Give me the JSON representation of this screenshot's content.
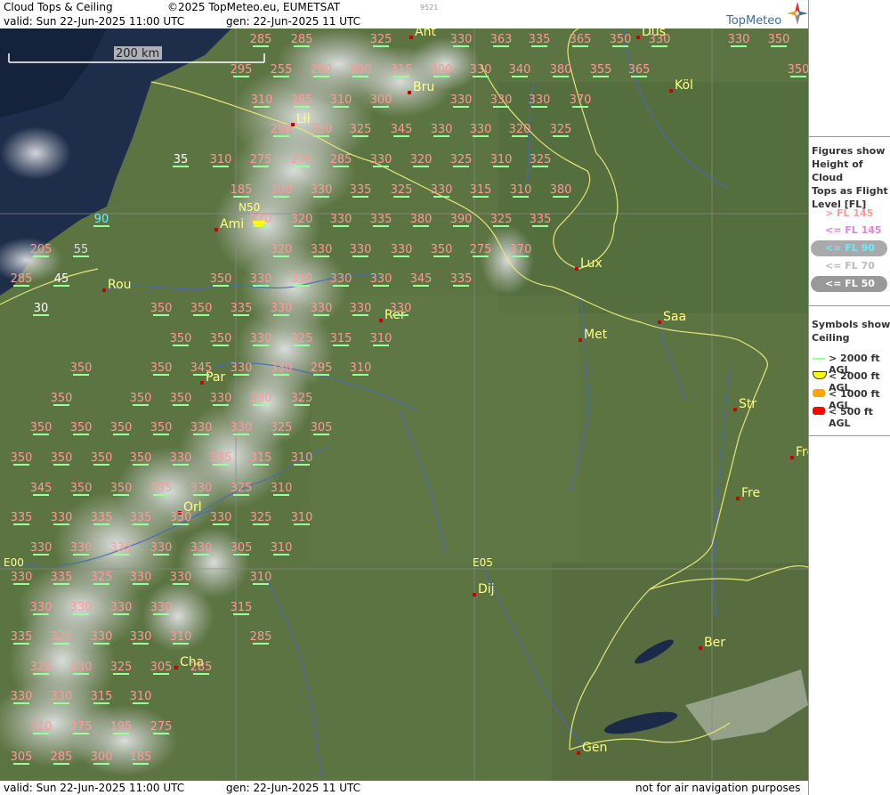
{
  "header": {
    "title": "Cloud Tops & Ceiling",
    "copyright": "©2025 TopMeteo.eu, EUMETSAT",
    "id": "9521",
    "valid": "valid:  Sun  22-Jun-2025  11:00 UTC",
    "gen": "gen: 22-Jun-2025 11 UTC",
    "brand": "TopMeteo"
  },
  "footer": {
    "valid": "valid:  Sun  22-Jun-2025  11:00 UTC",
    "gen": "gen: 22-Jun-2025 11 UTC",
    "disclaimer": "not for air navigation purposes"
  },
  "scale": {
    "label": "200 km"
  },
  "gridlabels": [
    {
      "text": "N50"
    },
    {
      "text": "E00"
    },
    {
      "text": "E05"
    }
  ],
  "cities": [
    {
      "name": "Ant"
    },
    {
      "name": "Düs"
    },
    {
      "name": "Bru"
    },
    {
      "name": "Köl"
    },
    {
      "name": "Lil"
    },
    {
      "name": "Ami"
    },
    {
      "name": "Lux"
    },
    {
      "name": "Rou"
    },
    {
      "name": "Rer"
    },
    {
      "name": "Saa"
    },
    {
      "name": "Met"
    },
    {
      "name": "Par"
    },
    {
      "name": "Str"
    },
    {
      "name": "Frei"
    },
    {
      "name": "Fre"
    },
    {
      "name": "Orl"
    },
    {
      "name": "Dij"
    },
    {
      "name": "Ber"
    },
    {
      "name": "Cha"
    },
    {
      "name": "Gen"
    }
  ],
  "cloud_tops": [
    {
      "v": "285",
      "c": "pink"
    },
    {
      "v": "285",
      "c": "pink"
    },
    {
      "v": "325",
      "c": "pink"
    },
    {
      "v": "330",
      "c": "pink"
    },
    {
      "v": "363",
      "c": "pink"
    },
    {
      "v": "335",
      "c": "pink"
    },
    {
      "v": "365",
      "c": "pink"
    },
    {
      "v": "350",
      "c": "pink"
    },
    {
      "v": "330",
      "c": "pink"
    },
    {
      "v": "330",
      "c": "pink"
    },
    {
      "v": "350",
      "c": "pink"
    },
    {
      "v": "295",
      "c": "pink"
    },
    {
      "v": "255",
      "c": "pink"
    },
    {
      "v": "290",
      "c": "pink"
    },
    {
      "v": "360",
      "c": "pink"
    },
    {
      "v": "315",
      "c": "pink"
    },
    {
      "v": "300",
      "c": "pink"
    },
    {
      "v": "330",
      "c": "pink"
    },
    {
      "v": "340",
      "c": "pink"
    },
    {
      "v": "380",
      "c": "pink"
    },
    {
      "v": "355",
      "c": "pink"
    },
    {
      "v": "365",
      "c": "pink"
    },
    {
      "v": "350",
      "c": "pink"
    },
    {
      "v": "310",
      "c": "pink"
    },
    {
      "v": "285",
      "c": "pink"
    },
    {
      "v": "310",
      "c": "pink"
    },
    {
      "v": "300",
      "c": "pink"
    },
    {
      "v": "330",
      "c": "pink"
    },
    {
      "v": "330",
      "c": "pink"
    },
    {
      "v": "330",
      "c": "pink"
    },
    {
      "v": "370",
      "c": "pink"
    },
    {
      "v": "290",
      "c": "pink"
    },
    {
      "v": "330",
      "c": "pink"
    },
    {
      "v": "325",
      "c": "pink"
    },
    {
      "v": "345",
      "c": "pink"
    },
    {
      "v": "330",
      "c": "pink"
    },
    {
      "v": "330",
      "c": "pink"
    },
    {
      "v": "320",
      "c": "pink"
    },
    {
      "v": "325",
      "c": "pink"
    },
    {
      "v": "35",
      "c": "white"
    },
    {
      "v": "310",
      "c": "pink"
    },
    {
      "v": "275",
      "c": "pink"
    },
    {
      "v": "270",
      "c": "pink"
    },
    {
      "v": "285",
      "c": "pink"
    },
    {
      "v": "330",
      "c": "pink"
    },
    {
      "v": "320",
      "c": "pink"
    },
    {
      "v": "325",
      "c": "pink"
    },
    {
      "v": "310",
      "c": "pink"
    },
    {
      "v": "325",
      "c": "pink"
    },
    {
      "v": "185",
      "c": "pink"
    },
    {
      "v": "300",
      "c": "pink"
    },
    {
      "v": "330",
      "c": "pink"
    },
    {
      "v": "335",
      "c": "pink"
    },
    {
      "v": "325",
      "c": "pink"
    },
    {
      "v": "330",
      "c": "pink"
    },
    {
      "v": "315",
      "c": "pink"
    },
    {
      "v": "310",
      "c": "pink"
    },
    {
      "v": "380",
      "c": "pink"
    },
    {
      "v": "90",
      "c": "cyan"
    },
    {
      "v": "270",
      "c": "pink"
    },
    {
      "v": "320",
      "c": "pink"
    },
    {
      "v": "330",
      "c": "pink"
    },
    {
      "v": "335",
      "c": "pink"
    },
    {
      "v": "380",
      "c": "pink"
    },
    {
      "v": "390",
      "c": "pink"
    },
    {
      "v": "325",
      "c": "pink"
    },
    {
      "v": "335",
      "c": "pink"
    },
    {
      "v": "205",
      "c": "pink"
    },
    {
      "v": "55",
      "c": "grey"
    },
    {
      "v": "320",
      "c": "pink"
    },
    {
      "v": "330",
      "c": "pink"
    },
    {
      "v": "330",
      "c": "pink"
    },
    {
      "v": "330",
      "c": "pink"
    },
    {
      "v": "350",
      "c": "pink"
    },
    {
      "v": "275",
      "c": "pink"
    },
    {
      "v": "370",
      "c": "pink"
    },
    {
      "v": "285",
      "c": "pink"
    },
    {
      "v": "45",
      "c": "white"
    },
    {
      "v": "350",
      "c": "pink"
    },
    {
      "v": "330",
      "c": "pink"
    },
    {
      "v": "330",
      "c": "pink"
    },
    {
      "v": "330",
      "c": "pink"
    },
    {
      "v": "330",
      "c": "pink"
    },
    {
      "v": "345",
      "c": "pink"
    },
    {
      "v": "335",
      "c": "pink"
    },
    {
      "v": "30",
      "c": "white"
    },
    {
      "v": "350",
      "c": "pink"
    },
    {
      "v": "350",
      "c": "pink"
    },
    {
      "v": "335",
      "c": "pink"
    },
    {
      "v": "330",
      "c": "pink"
    },
    {
      "v": "330",
      "c": "pink"
    },
    {
      "v": "330",
      "c": "pink"
    },
    {
      "v": "330",
      "c": "pink"
    },
    {
      "v": "350",
      "c": "pink"
    },
    {
      "v": "350",
      "c": "pink"
    },
    {
      "v": "330",
      "c": "pink"
    },
    {
      "v": "325",
      "c": "pink"
    },
    {
      "v": "315",
      "c": "pink"
    },
    {
      "v": "310",
      "c": "pink"
    },
    {
      "v": "350",
      "c": "pink"
    },
    {
      "v": "350",
      "c": "pink"
    },
    {
      "v": "345",
      "c": "pink"
    },
    {
      "v": "330",
      "c": "pink"
    },
    {
      "v": "330",
      "c": "pink"
    },
    {
      "v": "295",
      "c": "pink"
    },
    {
      "v": "310",
      "c": "pink"
    },
    {
      "v": "350",
      "c": "pink"
    },
    {
      "v": "350",
      "c": "pink"
    },
    {
      "v": "350",
      "c": "pink"
    },
    {
      "v": "330",
      "c": "pink"
    },
    {
      "v": "330",
      "c": "pink"
    },
    {
      "v": "325",
      "c": "pink"
    },
    {
      "v": "350",
      "c": "pink"
    },
    {
      "v": "350",
      "c": "pink"
    },
    {
      "v": "350",
      "c": "pink"
    },
    {
      "v": "350",
      "c": "pink"
    },
    {
      "v": "330",
      "c": "pink"
    },
    {
      "v": "330",
      "c": "pink"
    },
    {
      "v": "325",
      "c": "pink"
    },
    {
      "v": "305",
      "c": "pink"
    },
    {
      "v": "350",
      "c": "pink"
    },
    {
      "v": "350",
      "c": "pink"
    },
    {
      "v": "350",
      "c": "pink"
    },
    {
      "v": "350",
      "c": "pink"
    },
    {
      "v": "330",
      "c": "pink"
    },
    {
      "v": "335",
      "c": "pink"
    },
    {
      "v": "315",
      "c": "pink"
    },
    {
      "v": "310",
      "c": "pink"
    },
    {
      "v": "345",
      "c": "pink"
    },
    {
      "v": "350",
      "c": "pink"
    },
    {
      "v": "350",
      "c": "pink"
    },
    {
      "v": "335",
      "c": "pink"
    },
    {
      "v": "330",
      "c": "pink"
    },
    {
      "v": "325",
      "c": "pink"
    },
    {
      "v": "310",
      "c": "pink"
    },
    {
      "v": "335",
      "c": "pink"
    },
    {
      "v": "330",
      "c": "pink"
    },
    {
      "v": "335",
      "c": "pink"
    },
    {
      "v": "335",
      "c": "pink"
    },
    {
      "v": "330",
      "c": "pink"
    },
    {
      "v": "330",
      "c": "pink"
    },
    {
      "v": "325",
      "c": "pink"
    },
    {
      "v": "310",
      "c": "pink"
    },
    {
      "v": "330",
      "c": "pink"
    },
    {
      "v": "330",
      "c": "pink"
    },
    {
      "v": "335",
      "c": "pink"
    },
    {
      "v": "330",
      "c": "pink"
    },
    {
      "v": "330",
      "c": "pink"
    },
    {
      "v": "305",
      "c": "pink"
    },
    {
      "v": "310",
      "c": "pink"
    },
    {
      "v": "330",
      "c": "pink"
    },
    {
      "v": "335",
      "c": "pink"
    },
    {
      "v": "325",
      "c": "pink"
    },
    {
      "v": "330",
      "c": "pink"
    },
    {
      "v": "330",
      "c": "pink"
    },
    {
      "v": "310",
      "c": "pink"
    },
    {
      "v": "330",
      "c": "pink"
    },
    {
      "v": "330",
      "c": "pink"
    },
    {
      "v": "330",
      "c": "pink"
    },
    {
      "v": "330",
      "c": "pink"
    },
    {
      "v": "315",
      "c": "pink"
    },
    {
      "v": "335",
      "c": "pink"
    },
    {
      "v": "325",
      "c": "pink"
    },
    {
      "v": "330",
      "c": "pink"
    },
    {
      "v": "330",
      "c": "pink"
    },
    {
      "v": "310",
      "c": "pink"
    },
    {
      "v": "285",
      "c": "pink"
    },
    {
      "v": "325",
      "c": "pink"
    },
    {
      "v": "330",
      "c": "pink"
    },
    {
      "v": "325",
      "c": "pink"
    },
    {
      "v": "305",
      "c": "pink"
    },
    {
      "v": "285",
      "c": "pink"
    },
    {
      "v": "330",
      "c": "pink"
    },
    {
      "v": "330",
      "c": "pink"
    },
    {
      "v": "315",
      "c": "pink"
    },
    {
      "v": "310",
      "c": "pink"
    },
    {
      "v": "310",
      "c": "pink"
    },
    {
      "v": "275",
      "c": "pink"
    },
    {
      "v": "195",
      "c": "pink"
    },
    {
      "v": "275",
      "c": "pink"
    },
    {
      "v": "305",
      "c": "pink"
    },
    {
      "v": "285",
      "c": "pink"
    },
    {
      "v": "300",
      "c": "pink"
    },
    {
      "v": "185",
      "c": "pink"
    }
  ],
  "legend": {
    "figures_title": "Figures show Height of Cloud Tops as Flight Level  [FL]",
    "figures_lines": [
      "Figures show",
      "Height of Cloud",
      "Tops as Flight",
      "Level  [FL]"
    ],
    "fl": [
      {
        "label": "> FL 145",
        "color": "#ff9999",
        "bg": "none"
      },
      {
        "label": "<= FL 145",
        "color": "#e080e0",
        "bg": "none"
      },
      {
        "label": "<= FL 90",
        "color": "#66eeff",
        "bg": "#aaaaaa"
      },
      {
        "label": "<= FL 70",
        "color": "#bbbbbb",
        "bg": "none"
      },
      {
        "label": "<= FL 50",
        "color": "#ffffff",
        "bg": "#999999"
      }
    ],
    "symbols_lines": [
      "Symbols show",
      "Ceiling"
    ],
    "ceiling": [
      {
        "label": "> 2000 ft AGL",
        "color": "#99ff99"
      },
      {
        "label": "< 2000 ft AGL",
        "color": "#ffff00"
      },
      {
        "label": "< 1000 ft AGL",
        "color": "#ffa500"
      },
      {
        "label": "< 500 ft AGL",
        "color": "#ff0000"
      }
    ]
  },
  "colors": {
    "pink": "#ff9999",
    "white": "#ffffff",
    "cyan": "#66eeff",
    "grey": "#dddddd",
    "city": "#ffff80",
    "dot": "#cc0000"
  }
}
